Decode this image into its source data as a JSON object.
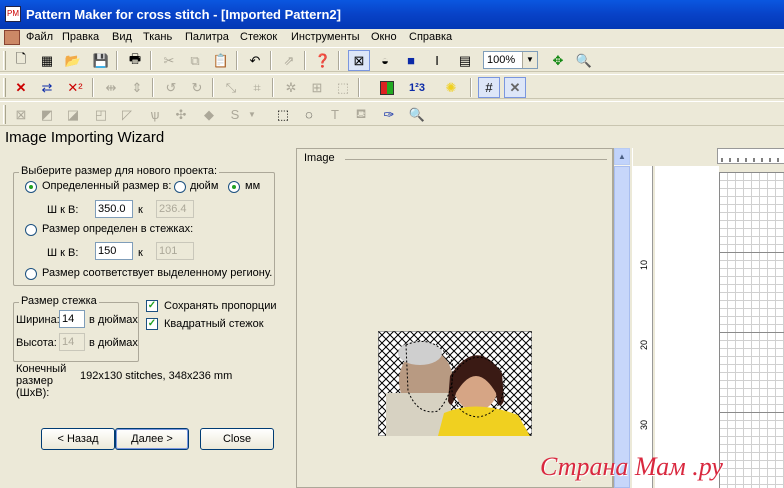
{
  "window": {
    "title": "Pattern Maker for cross stitch - [Imported Pattern2]"
  },
  "menu": [
    "Файл",
    "Правка",
    "Вид",
    "Ткань",
    "Палитра",
    "Стежок",
    "Инструменты",
    "Окно",
    "Справка"
  ],
  "toolbar": {
    "zoom_value": "100%"
  },
  "wizard": {
    "title": "Image Importing Wizard",
    "size_group": {
      "title": "Выберите размер для нового проекта:",
      "option1_label": "Определенный размер в:",
      "unit_inch": "дюйм",
      "unit_mm": "мм",
      "wh_label1": "Ш к В:",
      "width_mm": "350.0",
      "k_label1": "к",
      "height_mm": "236.4",
      "option2_label": "Размер определен в стежках:",
      "wh_label2": "Ш к В:",
      "width_st": "150",
      "k_label2": "к",
      "height_st": "101",
      "option3_label": "Размер соответствует выделенному региону."
    },
    "stitch_group": {
      "title": "Размер стежка",
      "width_label": "Ширина:",
      "width_value": "14",
      "width_unit": "в дюймах",
      "height_label": "Высота:",
      "height_value": "14",
      "height_unit": "в дюймах"
    },
    "keep_proportions": "Сохранять пропорции",
    "square_stitch": "Квадратный стежок",
    "final_size_label": "Конечный\nразмер\n(ШxВ):",
    "final_size_value": "192x130 stitches,  348x236 mm",
    "back_button": "< Назад",
    "next_button": "Далее >",
    "close_button": "Close"
  },
  "image_panel": {
    "title": "Image"
  },
  "ruler": {
    "ticks": [
      "10",
      "20",
      "30"
    ]
  },
  "watermark": "Страна Мам .ру",
  "colors": {
    "title_blue": "#0842c7",
    "face_bg": "#ece9d8",
    "accent_yellow": "#f0d020"
  }
}
